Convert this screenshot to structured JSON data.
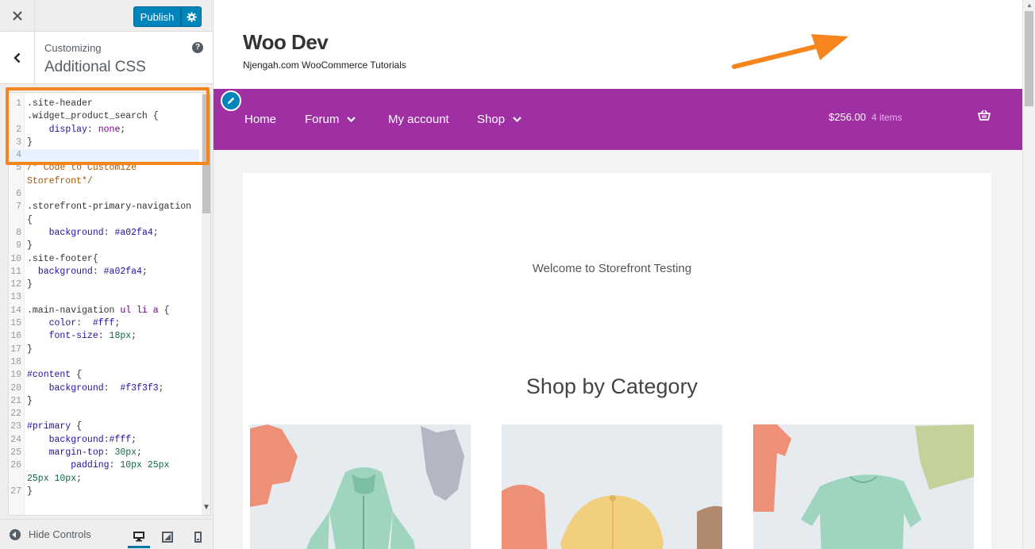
{
  "customizer": {
    "publish_label": "Publish",
    "section_subtitle": "Customizing",
    "section_title": "Additional CSS",
    "hide_controls_label": "Hide Controls",
    "accent_color": "#0085ba"
  },
  "css_editor": {
    "lines": [
      {
        "n": "1",
        "html": ".site-header"
      },
      {
        "n": "",
        "html": ".widget_product_search {"
      },
      {
        "n": "2",
        "html": "    <span class=\"c-at\">display</span>: <span class=\"c-kw\">none</span>;"
      },
      {
        "n": "3",
        "html": "}"
      },
      {
        "n": "4",
        "html": "",
        "active": true
      },
      {
        "n": "5",
        "html": "<span class=\"c-cm\">/* Code to Customize</span>"
      },
      {
        "n": "",
        "html": "<span class=\"c-cm\">Storefront*/</span>"
      },
      {
        "n": "6",
        "html": ""
      },
      {
        "n": "7",
        "html": ".storefront-primary-navigation"
      },
      {
        "n": "",
        "html": "{"
      },
      {
        "n": "8",
        "html": "    <span class=\"c-at\">background</span>: <span class=\"c-at\">#a02fa4</span>;"
      },
      {
        "n": "9",
        "html": "}"
      },
      {
        "n": "10",
        "html": ".site-footer{"
      },
      {
        "n": "11",
        "html": "  <span class=\"c-at\">background</span>: <span class=\"c-at\">#a02fa4</span>;"
      },
      {
        "n": "12",
        "html": "}"
      },
      {
        "n": "13",
        "html": ""
      },
      {
        "n": "14",
        "html": ".main-navigation <span class=\"c-kw\">ul li a</span> {"
      },
      {
        "n": "15",
        "html": "    <span class=\"c-at\">color</span>:  <span class=\"c-at\">#fff</span>;"
      },
      {
        "n": "16",
        "html": "    <span class=\"c-at\">font-size</span>: <span class=\"c-nm\">18px</span>;"
      },
      {
        "n": "17",
        "html": "}"
      },
      {
        "n": "18",
        "html": ""
      },
      {
        "n": "19",
        "html": "<span class=\"c-at\">#content</span> {"
      },
      {
        "n": "20",
        "html": "    <span class=\"c-at\">background</span>:  <span class=\"c-at\">#f3f3f3</span>;"
      },
      {
        "n": "21",
        "html": "}"
      },
      {
        "n": "22",
        "html": ""
      },
      {
        "n": "23",
        "html": "<span class=\"c-at\">#primary</span> {"
      },
      {
        "n": "24",
        "html": "    <span class=\"c-at\">background</span>:<span class=\"c-at\">#fff</span>;"
      },
      {
        "n": "25",
        "html": "    <span class=\"c-at\">margin-top</span>: <span class=\"c-nm\">30px</span>;"
      },
      {
        "n": "26",
        "html": "        <span class=\"c-at\">padding</span>: <span class=\"c-nm\">10px 25px</span>"
      },
      {
        "n": "",
        "html": "<span class=\"c-nm\">25px 10px</span>;"
      },
      {
        "n": "27",
        "html": "}"
      }
    ]
  },
  "site": {
    "title": "Woo Dev",
    "tagline": "Njengah.com WooCommerce Tutorials",
    "nav_color": "#a02fa4",
    "nav": [
      {
        "label": "Home"
      },
      {
        "label": "Forum"
      },
      {
        "label": "My account"
      },
      {
        "label": "Shop"
      }
    ],
    "cart_amount": "$256.00",
    "cart_count": "4 items",
    "welcome": "Welcome to Storefront Testing",
    "shop_heading": "Shop by Category"
  },
  "annotation": {
    "highlight_color": "#f7851d"
  }
}
